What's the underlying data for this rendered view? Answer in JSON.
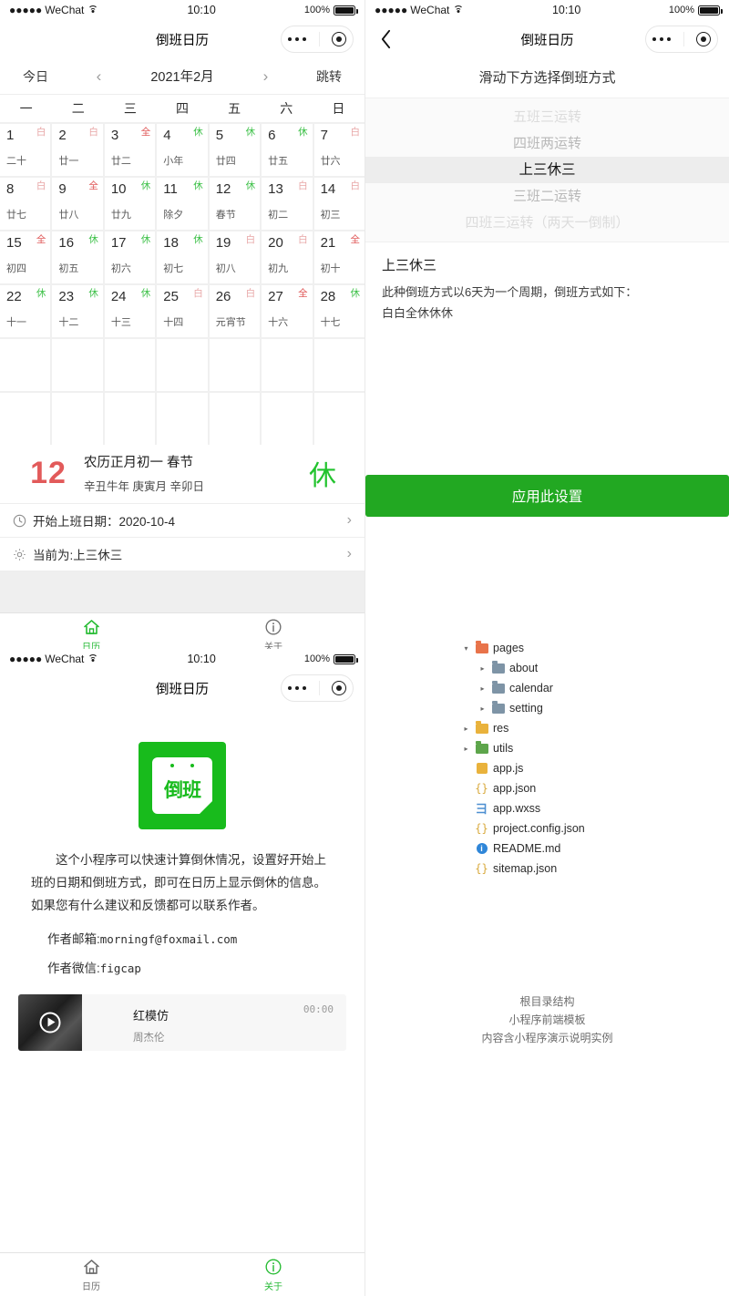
{
  "status_bar": {
    "carrier": "WeChat",
    "dots": "●●●●●",
    "time": "10:10",
    "battery": "100%"
  },
  "calendar_page": {
    "nav_title": "倒班日历",
    "controls": {
      "today": "今日",
      "prev": "‹",
      "month": "2021年2月",
      "next": "›",
      "jump": "跳转"
    },
    "weekdays": [
      "一",
      "二",
      "三",
      "四",
      "五",
      "六",
      "日"
    ],
    "days": [
      {
        "n": "1",
        "lunar": "二十",
        "badge": "白",
        "type": "bai"
      },
      {
        "n": "2",
        "lunar": "廿一",
        "badge": "白",
        "type": "bai"
      },
      {
        "n": "3",
        "lunar": "廿二",
        "badge": "全",
        "type": "quan"
      },
      {
        "n": "4",
        "lunar": "小年",
        "badge": "休",
        "type": "xiu"
      },
      {
        "n": "5",
        "lunar": "廿四",
        "badge": "休",
        "type": "xiu"
      },
      {
        "n": "6",
        "lunar": "廿五",
        "badge": "休",
        "type": "xiu"
      },
      {
        "n": "7",
        "lunar": "廿六",
        "badge": "白",
        "type": "bai"
      },
      {
        "n": "8",
        "lunar": "廿七",
        "badge": "白",
        "type": "bai"
      },
      {
        "n": "9",
        "lunar": "廿八",
        "badge": "全",
        "type": "quan"
      },
      {
        "n": "10",
        "lunar": "廿九",
        "badge": "休",
        "type": "xiu"
      },
      {
        "n": "11",
        "lunar": "除夕",
        "badge": "休",
        "type": "xiu"
      },
      {
        "n": "12",
        "lunar": "春节",
        "badge": "休",
        "type": "xiu"
      },
      {
        "n": "13",
        "lunar": "初二",
        "badge": "白",
        "type": "bai"
      },
      {
        "n": "14",
        "lunar": "初三",
        "badge": "白",
        "type": "bai"
      },
      {
        "n": "15",
        "lunar": "初四",
        "badge": "全",
        "type": "quan"
      },
      {
        "n": "16",
        "lunar": "初五",
        "badge": "休",
        "type": "xiu"
      },
      {
        "n": "17",
        "lunar": "初六",
        "badge": "休",
        "type": "xiu"
      },
      {
        "n": "18",
        "lunar": "初七",
        "badge": "休",
        "type": "xiu"
      },
      {
        "n": "19",
        "lunar": "初八",
        "badge": "白",
        "type": "bai"
      },
      {
        "n": "20",
        "lunar": "初九",
        "badge": "白",
        "type": "bai"
      },
      {
        "n": "21",
        "lunar": "初十",
        "badge": "全",
        "type": "quan"
      },
      {
        "n": "22",
        "lunar": "十一",
        "badge": "休",
        "type": "xiu"
      },
      {
        "n": "23",
        "lunar": "十二",
        "badge": "休",
        "type": "xiu"
      },
      {
        "n": "24",
        "lunar": "十三",
        "badge": "休",
        "type": "xiu"
      },
      {
        "n": "25",
        "lunar": "十四",
        "badge": "白",
        "type": "bai"
      },
      {
        "n": "26",
        "lunar": "元宵节",
        "badge": "白",
        "type": "bai"
      },
      {
        "n": "27",
        "lunar": "十六",
        "badge": "全",
        "type": "quan"
      },
      {
        "n": "28",
        "lunar": "十七",
        "badge": "休",
        "type": "xiu"
      }
    ],
    "detail": {
      "day_number": "12",
      "lunar_line": "农历正月初一  春节",
      "ganzhi_line": "辛丑牛年  庚寅月  辛卯日",
      "rest_mark": "休"
    },
    "rows": [
      {
        "icon": "clock-icon",
        "label": "开始上班日期：2020-10-4",
        "arrow": "›"
      },
      {
        "icon": "gear-icon",
        "label": "当前为:上三休三",
        "arrow": "›"
      }
    ]
  },
  "setting_page": {
    "nav_title": "倒班日历",
    "back": "‹",
    "hint": "滑动下方选择倒班方式",
    "picker_options": [
      "五班三运转",
      "四班两运转",
      "上三休三",
      "三班二运转",
      "四班三运转（两天一倒制）"
    ],
    "picker_selected_index": 2,
    "desc_title": "上三休三",
    "desc_line1": "此种倒班方式以6天为一个周期，倒班方式如下：",
    "desc_line2": "白白全休休休",
    "apply_label": "应用此设置"
  },
  "about_page": {
    "nav_title": "倒班日历",
    "logo_text": "倒班",
    "intro": "这个小程序可以快速计算倒休情况，设置好开始上班的日期和倒班方式，即可在日历上显示倒休的信息。如果您有什么建议和反馈都可以联系作者。",
    "email_label": "作者邮箱:",
    "email_value": "morningf@foxmail.com",
    "wechat_label": "作者微信:",
    "wechat_value": "figcap",
    "music": {
      "title": "红模仿",
      "artist": "周杰伦",
      "time": "00:00"
    }
  },
  "tabbar": {
    "calendar_label": "日历",
    "about_label": "关于"
  },
  "file_tree": {
    "nodes": [
      {
        "depth": 0,
        "arrow": "▾",
        "label": "pages",
        "icon": "folder-pages",
        "color": "#e8734a"
      },
      {
        "depth": 1,
        "arrow": "▸",
        "label": "about",
        "icon": "folder",
        "color": "#7e94a6"
      },
      {
        "depth": 1,
        "arrow": "▸",
        "label": "calendar",
        "icon": "folder",
        "color": "#7e94a6"
      },
      {
        "depth": 1,
        "arrow": "▸",
        "label": "setting",
        "icon": "folder",
        "color": "#7e94a6"
      },
      {
        "depth": 0,
        "arrow": "▸",
        "label": "res",
        "icon": "folder-res",
        "color": "#e9b23c"
      },
      {
        "depth": 0,
        "arrow": "▸",
        "label": "utils",
        "icon": "folder-utils",
        "color": "#5da54b"
      },
      {
        "depth": 0,
        "arrow": "",
        "label": "app.js",
        "icon": "js-file",
        "color": "#e9b23c"
      },
      {
        "depth": 0,
        "arrow": "",
        "label": "app.json",
        "icon": "json-file",
        "color": "#d8a93b"
      },
      {
        "depth": 0,
        "arrow": "",
        "label": "app.wxss",
        "icon": "css-file",
        "color": "#4d8fd1"
      },
      {
        "depth": 0,
        "arrow": "",
        "label": "project.config.json",
        "icon": "json-file",
        "color": "#d8a93b"
      },
      {
        "depth": 0,
        "arrow": "",
        "label": "README.md",
        "icon": "info-file",
        "color": "#2f86d8"
      },
      {
        "depth": 0,
        "arrow": "",
        "label": "sitemap.json",
        "icon": "json-file",
        "color": "#d8a93b"
      }
    ],
    "caption_lines": [
      "根目录结构",
      "小程序前端模板",
      "内容含小程序演示说明实例"
    ]
  },
  "colors": {
    "brand_green": "#22a822",
    "accent_red": "#e25a5a",
    "rest_green": "#22c32e",
    "badge_bai": "#e8a6a6",
    "badge_quan": "#e05b5b"
  }
}
